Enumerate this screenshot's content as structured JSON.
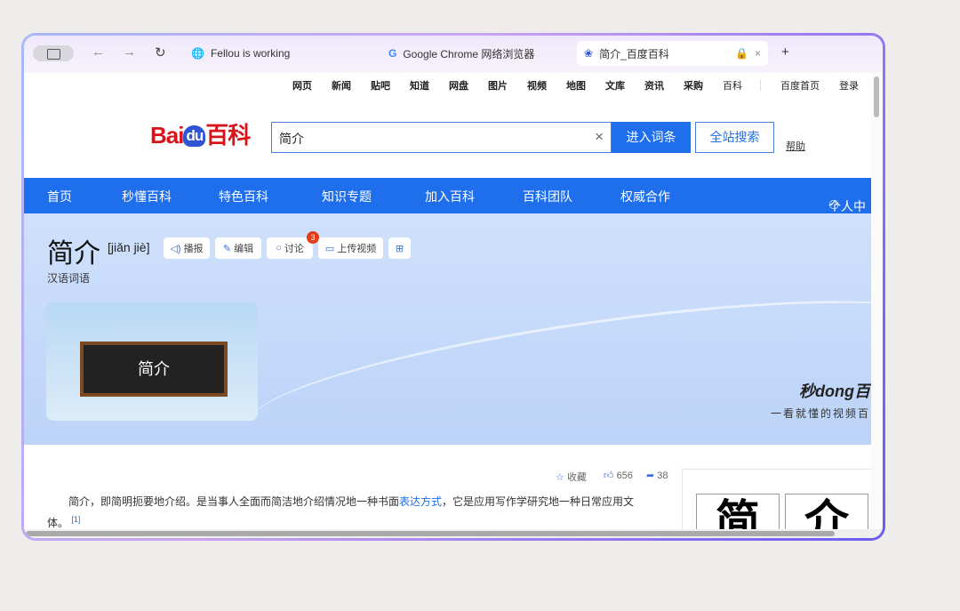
{
  "browser": {
    "tabs": [
      {
        "label": "Fellou is working"
      },
      {
        "label": "Google Chrome 网络浏览器"
      },
      {
        "label": "简介_百度百科"
      }
    ],
    "new_tab": "+"
  },
  "topnav": {
    "items": [
      "网页",
      "新闻",
      "贴吧",
      "知道",
      "网盘",
      "图片",
      "视频",
      "地图",
      "文库",
      "资讯",
      "采购",
      "百科"
    ],
    "home": "百度首页",
    "login": "登录"
  },
  "header": {
    "logo_text": "Bai",
    "logo_du": "du",
    "logo_suffix": "百科",
    "search_value": "简介",
    "enter_label": "进入词条",
    "all_search_label": "全站搜索",
    "help": "帮助"
  },
  "bluenav": {
    "items": [
      "首页",
      "秒懂百科",
      "特色百科",
      "知识专题",
      "加入百科",
      "百科团队",
      "权威合作"
    ],
    "personal": "个人中"
  },
  "entry": {
    "title": "简介",
    "pinyin": "[jiǎn jiè]",
    "buttons": {
      "play": "播报",
      "edit": "编辑",
      "discuss": "讨论",
      "upload": "上传视频"
    },
    "discuss_count": "3",
    "category": "汉语词语",
    "thumb_text": "简介",
    "brand": "秒dong百",
    "slogan": "一看就懂的视频百"
  },
  "stats": {
    "collect": "收藏",
    "likes": "656",
    "shares": "38"
  },
  "content": {
    "p1_a": "简介，即简明扼要地介绍。是当事人全面而简洁地介绍情况地一种书面",
    "p1_link": "表达方式",
    "p1_b": "，它是应用写作学研究地一种日常应用文体。",
    "ref": "[1]",
    "chars": [
      "简",
      "介"
    ]
  }
}
